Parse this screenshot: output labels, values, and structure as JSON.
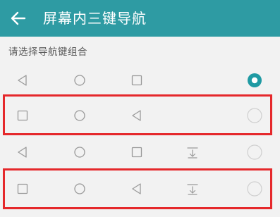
{
  "header": {
    "title": "屏幕内三键导航",
    "back_icon": "arrow-left-icon"
  },
  "section": {
    "label": "请选择导航键组合"
  },
  "options": [
    {
      "icons": [
        "back-triangle-icon",
        "home-circle-icon",
        "recent-square-icon"
      ],
      "selected": true,
      "highlighted": false
    },
    {
      "icons": [
        "recent-square-icon",
        "home-circle-icon",
        "back-triangle-icon"
      ],
      "selected": false,
      "highlighted": true
    },
    {
      "icons": [
        "back-triangle-icon",
        "home-circle-icon",
        "recent-square-icon",
        "notification-pull-down-icon"
      ],
      "selected": false,
      "highlighted": false
    },
    {
      "icons": [
        "recent-square-icon",
        "home-circle-icon",
        "back-triangle-icon",
        "notification-pull-down-icon"
      ],
      "selected": false,
      "highlighted": true
    }
  ],
  "colors": {
    "appbar": "#2e9ba3",
    "accent": "#1f9aa3",
    "highlight_frame": "#e5282b",
    "icon": "#9a9a9a",
    "background": "#f2f2f2"
  }
}
